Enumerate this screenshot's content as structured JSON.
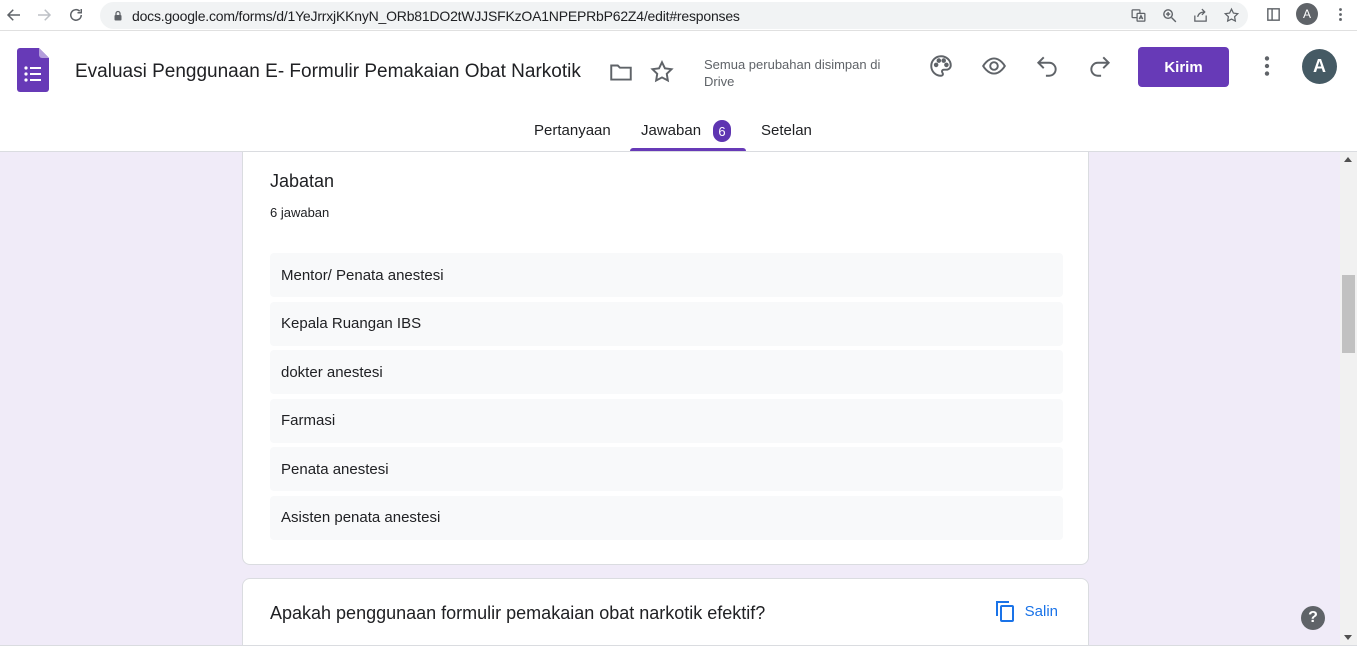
{
  "browser": {
    "url": "docs.google.com/forms/d/1YeJrrxjKKnyN_ORb81DO2tWJJSFKzOA1NPEPRbP62Z4/edit#responses",
    "profile_initial": "A"
  },
  "header": {
    "title": "Evaluasi Penggunaan E- Formulir Pemakaian Obat Narkotik",
    "save_status": "Semua perubahan disimpan di Drive",
    "send_label": "Kirim",
    "avatar_initial": "A",
    "accent_color": "#673ab7"
  },
  "tabs": [
    {
      "label": "Pertanyaan",
      "active": false
    },
    {
      "label": "Jawaban",
      "active": true,
      "badge": "6"
    },
    {
      "label": "Setelan",
      "active": false
    }
  ],
  "question_card": {
    "title": "Jabatan",
    "count": "6 jawaban",
    "answers": [
      "Mentor/ Penata anestesi",
      "Kepala Ruangan IBS",
      "dokter anestesi",
      "Farmasi",
      "Penata anestesi",
      "Asisten penata anestesi"
    ]
  },
  "next_card": {
    "title": "Apakah penggunaan formulir pemakaian obat narkotik efektif?",
    "copy_label": "Salin"
  },
  "help_label": "?"
}
